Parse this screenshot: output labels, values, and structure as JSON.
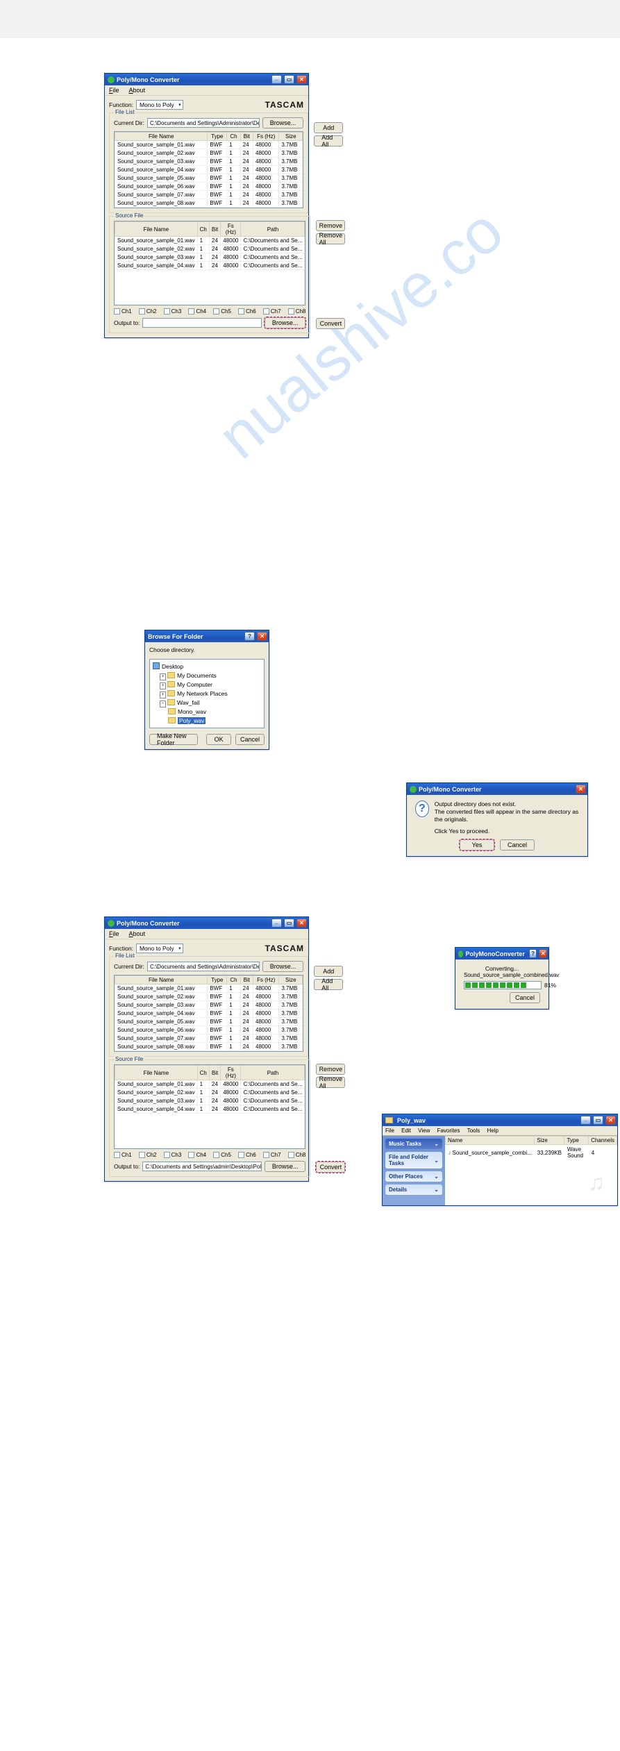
{
  "watermark": "nualshive.co",
  "main": {
    "title": "Poly/Mono Converter",
    "menus": {
      "file": "File",
      "about": "About"
    },
    "functionLabel": "Function:",
    "functionSelected": "Mono to Poly",
    "brand": "TASCAM",
    "fileList": {
      "legend": "File List",
      "curDirLabel": "Current Dir:",
      "curDir": "C:\\Documents and Settings\\Administrator\\Deskt",
      "browse": "Browse...",
      "add": "Add",
      "addAll": "Add All",
      "cols": [
        "File Name",
        "Type",
        "Ch",
        "Bit",
        "Fs (Hz)",
        "Size"
      ],
      "rows": [
        [
          "Sound_source_sample_01.wav",
          "BWF",
          "1",
          "24",
          "48000",
          "3.7MB"
        ],
        [
          "Sound_source_sample_02.wav",
          "BWF",
          "1",
          "24",
          "48000",
          "3.7MB"
        ],
        [
          "Sound_source_sample_03.wav",
          "BWF",
          "1",
          "24",
          "48000",
          "3.7MB"
        ],
        [
          "Sound_source_sample_04.wav",
          "BWF",
          "1",
          "24",
          "48000",
          "3.7MB"
        ],
        [
          "Sound_source_sample_05.wav",
          "BWF",
          "1",
          "24",
          "48000",
          "3.7MB"
        ],
        [
          "Sound_source_sample_06.wav",
          "BWF",
          "1",
          "24",
          "48000",
          "3.7MB"
        ],
        [
          "Sound_source_sample_07.wav",
          "BWF",
          "1",
          "24",
          "48000",
          "3.7MB"
        ],
        [
          "Sound_source_sample_08.wav",
          "BWF",
          "1",
          "24",
          "48000",
          "3.7MB"
        ]
      ]
    },
    "sourceFile": {
      "legend": "Source File",
      "remove": "Remove",
      "removeAll": "Remove All",
      "cols": [
        "File Name",
        "Ch",
        "Bit",
        "Fs (Hz)",
        "Path"
      ],
      "rows": [
        [
          "Sound_source_sample_01.wav",
          "1",
          "24",
          "48000",
          "C:\\Documents and Se..."
        ],
        [
          "Sound_source_sample_02.wav",
          "1",
          "24",
          "48000",
          "C:\\Documents and Se..."
        ],
        [
          "Sound_source_sample_03.wav",
          "1",
          "24",
          "48000",
          "C:\\Documents and Se..."
        ],
        [
          "Sound_source_sample_04.wav",
          "1",
          "24",
          "48000",
          "C:\\Documents and Se..."
        ]
      ],
      "channels": [
        "Ch1",
        "Ch2",
        "Ch3",
        "Ch4",
        "Ch5",
        "Ch6",
        "Ch7",
        "Ch8"
      ],
      "outputLabel": "Output to:",
      "outputValue": "",
      "convert": "Convert"
    }
  },
  "browse": {
    "title": "Browse For Folder",
    "prompt": "Choose directory.",
    "nodes": {
      "desktop": "Desktop",
      "mydocs": "My Documents",
      "mycomp": "My Computer",
      "mynet": "My Network Places",
      "wavfail": "Wav_fail",
      "mono": "Mono_wav",
      "poly": "Poly_wav"
    },
    "makeNew": "Make New Folder",
    "ok": "OK",
    "cancel": "Cancel"
  },
  "main2": {
    "outputValue": "C:\\Documents and Settings\\admin\\Desktop\\Poly"
  },
  "confirm": {
    "title": "Poly/Mono Converter",
    "l1": "Output directory does not exist.",
    "l2": "The converted files will appear in the same directory as the originals.",
    "l3": "Click Yes to proceed.",
    "yes": "Yes",
    "cancel": "Cancel"
  },
  "progress": {
    "title": "PolyMonoConverter",
    "l1": "Converting...",
    "l2": "Sound_source_sample_combined.wav",
    "pct": "81%",
    "cancel": "Cancel"
  },
  "explorer": {
    "title": "Poly_wav",
    "menus": [
      "File",
      "Edit",
      "View",
      "Favorites",
      "Tools",
      "Help"
    ],
    "sideCards": [
      "Music Tasks",
      "File and Folder Tasks",
      "Other Places",
      "Details"
    ],
    "cols": [
      "Name",
      "Size",
      "Type",
      "Channels"
    ],
    "row": {
      "name": "Sound_source_sample_combi...",
      "size": "33,239KB",
      "type": "Wave Sound",
      "channels": "4"
    }
  }
}
